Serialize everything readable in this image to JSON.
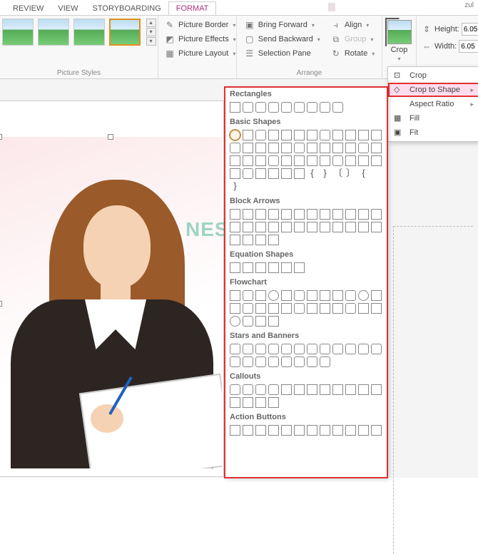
{
  "accountHint": "zul",
  "tabs": {
    "review": "REVIEW",
    "view": "VIEW",
    "storyboarding": "STORYBOARDING",
    "format": "FORMAT"
  },
  "groups": {
    "pictureStyles": "Picture Styles",
    "arrange": "Arrange"
  },
  "cmds": {
    "pictureBorder": "Picture Border",
    "pictureEffects": "Picture Effects",
    "pictureLayout": "Picture Layout",
    "bringForward": "Bring Forward",
    "sendBackward": "Send Backward",
    "selectionPane": "Selection Pane",
    "align": "Align",
    "group": "Group",
    "rotate": "Rotate",
    "crop": "Crop"
  },
  "size": {
    "heightLabel": "Height:",
    "heightVal": "6.05",
    "widthLabel": "Width:",
    "widthVal": "6.05"
  },
  "cropMenu": {
    "crop": "Crop",
    "cropToShape": "Crop to Shape",
    "aspectRatio": "Aspect Ratio",
    "fill": "Fill",
    "fit": "Fit"
  },
  "shapeCats": {
    "rectangles": "Rectangles",
    "basicShapes": "Basic Shapes",
    "blockArrows": "Block Arrows",
    "equationShapes": "Equation Shapes",
    "flowchart": "Flowchart",
    "starsBanners": "Stars and Banners",
    "callouts": "Callouts",
    "actionButtons": "Action Buttons"
  },
  "counts": {
    "rectangles": 9,
    "basicShapes": 42,
    "brackets": [
      "{",
      "}",
      "〔",
      "〕",
      "{",
      " ",
      "}"
    ],
    "blockArrows": 28,
    "equationShapes": 6,
    "flowchart": 28,
    "starsBanners": 20,
    "callouts": 16,
    "actionButtons": 12
  },
  "watermark": "NESABAMEDIA"
}
